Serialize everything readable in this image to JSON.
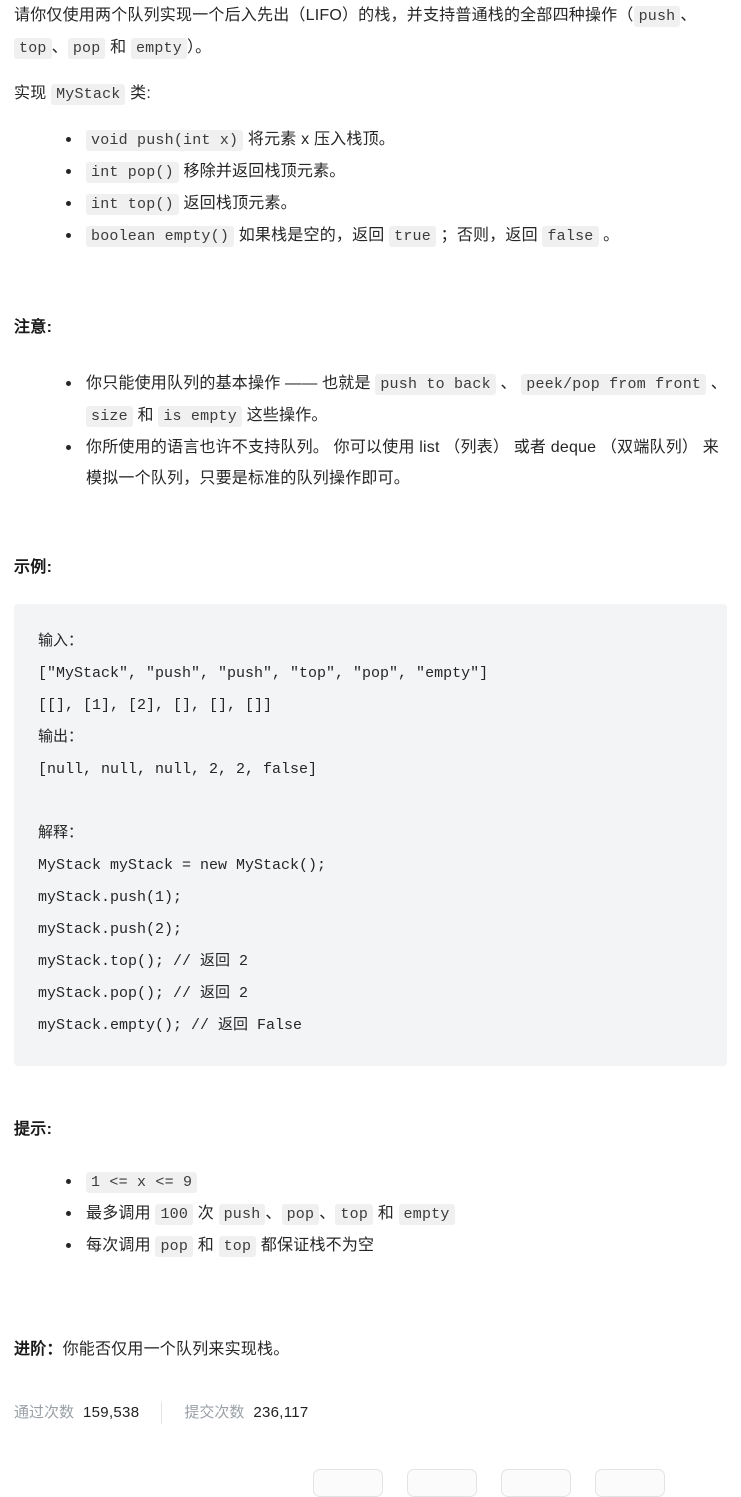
{
  "intro": {
    "line1_a": "请你仅使用两个队列实现一个后入先出（LIFO）的栈，并支持普通栈的全部四种操作（",
    "code_push": "push",
    "sep1": "、",
    "code_top": "top",
    "sep2": "、",
    "code_pop": "pop",
    "and_word": "和",
    "code_empty": "empty",
    "line1_b": "）。",
    "impl_prefix": "实现",
    "impl_class": "MyStack",
    "impl_suffix": "类:"
  },
  "methods": [
    {
      "code": "void push(int x)",
      "text": "将元素 x 压入栈顶。"
    },
    {
      "code": "int pop()",
      "text": "移除并返回栈顶元素。"
    },
    {
      "code": "int top()",
      "text": "返回栈顶元素。"
    },
    {
      "code": "boolean empty()",
      "text_a": "如果栈是空的，返回",
      "code_true": "true",
      "text_b": "；否则，返回",
      "code_false": "false",
      "text_c": "。"
    }
  ],
  "notes": {
    "heading": "注意:",
    "item1": {
      "a": "你只能使用队列的基本操作 —— 也就是",
      "c1": "push to back",
      "s1": "、",
      "c2": "peek/pop from front",
      "s2": "、",
      "c3": "size",
      "and": "和",
      "c4": "is empty",
      "b": "这些操作。"
    },
    "item2": "你所使用的语言也许不支持队列。 你可以使用 list （列表） 或者 deque （双端队列） 来模拟一个队列，只要是标准的队列操作即可。"
  },
  "example": {
    "heading": "示例:",
    "input_label": "输入：",
    "input_line1": "[\"MyStack\", \"push\", \"push\", \"top\", \"pop\", \"empty\"]",
    "input_line2": "[[], [1], [2], [], [], []]",
    "output_label": "输出：",
    "output_line": "[null, null, null, 2, 2, false]",
    "explain_label": "解释：",
    "explain_lines": [
      "MyStack myStack = new MyStack();",
      "myStack.push(1);",
      "myStack.push(2);",
      "myStack.top(); // 返回 2",
      "myStack.pop(); // 返回 2",
      "myStack.empty(); // 返回 False"
    ]
  },
  "hints": {
    "heading": "提示:",
    "item1_code": "1 <= x <= 9",
    "item2": {
      "a": "最多调用",
      "n": "100",
      "b": "次",
      "c1": "push",
      "s1": "、",
      "c2": "pop",
      "s2": "、",
      "c3": "top",
      "and": "和",
      "c4": "empty"
    },
    "item3": {
      "a": "每次调用",
      "c1": "pop",
      "and": "和",
      "c2": "top",
      "b": "都保证栈不为空"
    }
  },
  "advanced": {
    "label": "进阶：",
    "text": "你能否仅用一个队列来实现栈。"
  },
  "stats": {
    "accepted_label": "通过次数",
    "accepted_value": "159,538",
    "submissions_label": "提交次数",
    "submissions_value": "236,117"
  },
  "tags": [
    "",
    "",
    "",
    ""
  ],
  "colors": {
    "text": "#262626",
    "muted": "#9aa0a6",
    "code_bg": "#f0f0f0",
    "block_bg": "#f3f4f5"
  }
}
